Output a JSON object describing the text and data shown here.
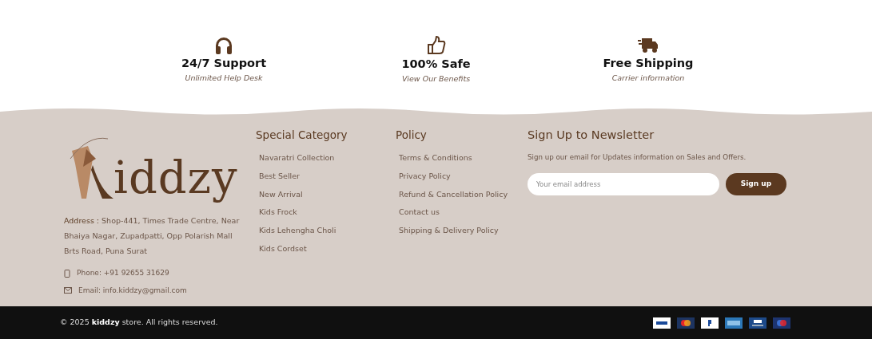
{
  "features": [
    {
      "kind": "support",
      "title": "24/7 Support",
      "subtitle": "Unlimited Help Desk"
    },
    {
      "kind": "safe",
      "title": "100% Safe",
      "subtitle": "View Our Benefits"
    },
    {
      "kind": "shipping",
      "title": "Free Shipping",
      "subtitle": "Carrier information"
    }
  ],
  "brand": {
    "logo_text": "iddzy",
    "address_label": "Address :",
    "address": "Shop-441, Times Trade Centre, Near Bhaiya Nagar, Zupadpatti, Opp Polarish Mall Brts Road, Puna Surat",
    "phone": "Phone: +91 92655 31629",
    "email": "Email: info.kiddzy@gmail.com"
  },
  "link_columns": [
    {
      "title": "Special Category",
      "links": [
        "Navaratri Collection",
        "Best Seller",
        "New Arrival",
        "Kids Frock",
        "Kids Lehengha Choli",
        "Kids Cordset"
      ]
    },
    {
      "title": "Policy",
      "links": [
        "Terms & Conditions",
        "Privacy Policy",
        "Refund & Cancellation Policy",
        "Contact us",
        "Shipping & Delivery Policy"
      ]
    }
  ],
  "newsletter": {
    "title": "Sign Up to Newsletter",
    "text": "Sign up our email for Updates information on Sales and Offers.",
    "placeholder": "Your email address",
    "button": "Sign up"
  },
  "copyright": "© 2025 **kiddzy** store. All rights reserved.",
  "payment_cards": [
    {
      "kind": "visa"
    },
    {
      "kind": "mastercard"
    },
    {
      "kind": "paypal"
    },
    {
      "kind": "amex"
    },
    {
      "kind": "visa-electron"
    },
    {
      "kind": "maestro"
    }
  ]
}
